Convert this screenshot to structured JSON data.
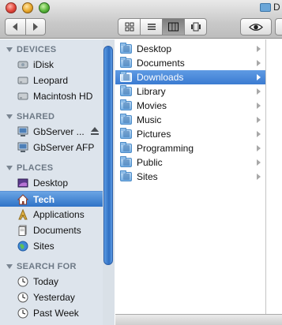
{
  "window": {
    "title": "D"
  },
  "toolbar": {
    "back_icon": "chevron-left-icon",
    "forward_icon": "chevron-right-icon",
    "view_modes": [
      "icon",
      "list",
      "column",
      "coverflow"
    ],
    "active_view": "column",
    "quicklook_icon": "eye-icon"
  },
  "sidebar": {
    "devices": {
      "label": "DEVICES",
      "items": [
        {
          "label": "iDisk",
          "icon": "idisk-icon"
        },
        {
          "label": "Leopard",
          "icon": "hard-drive-icon"
        },
        {
          "label": "Macintosh HD",
          "icon": "hard-drive-icon"
        }
      ]
    },
    "shared": {
      "label": "SHARED",
      "items": [
        {
          "label": "GbServer ...",
          "icon": "server-icon",
          "eject": true
        },
        {
          "label": "GbServer AFP",
          "icon": "server-icon"
        }
      ]
    },
    "places": {
      "label": "PLACES",
      "items": [
        {
          "label": "Desktop",
          "icon": "desktop-icon"
        },
        {
          "label": "Tech",
          "icon": "home-icon",
          "selected": true
        },
        {
          "label": "Applications",
          "icon": "applications-icon"
        },
        {
          "label": "Documents",
          "icon": "documents-icon"
        },
        {
          "label": "Sites",
          "icon": "globe-icon"
        }
      ]
    },
    "search": {
      "label": "SEARCH FOR",
      "items": [
        {
          "label": "Today",
          "icon": "clock-icon"
        },
        {
          "label": "Yesterday",
          "icon": "clock-icon"
        },
        {
          "label": "Past Week",
          "icon": "clock-icon"
        }
      ]
    }
  },
  "column": {
    "items": [
      {
        "label": "Desktop"
      },
      {
        "label": "Documents"
      },
      {
        "label": "Downloads",
        "selected": true
      },
      {
        "label": "Library"
      },
      {
        "label": "Movies"
      },
      {
        "label": "Music"
      },
      {
        "label": "Pictures"
      },
      {
        "label": "Programming"
      },
      {
        "label": "Public"
      },
      {
        "label": "Sites"
      }
    ]
  },
  "colors": {
    "selection": "#3b7bd1",
    "sidebar_bg": "#dde4ec",
    "section_header": "#6d7986"
  }
}
